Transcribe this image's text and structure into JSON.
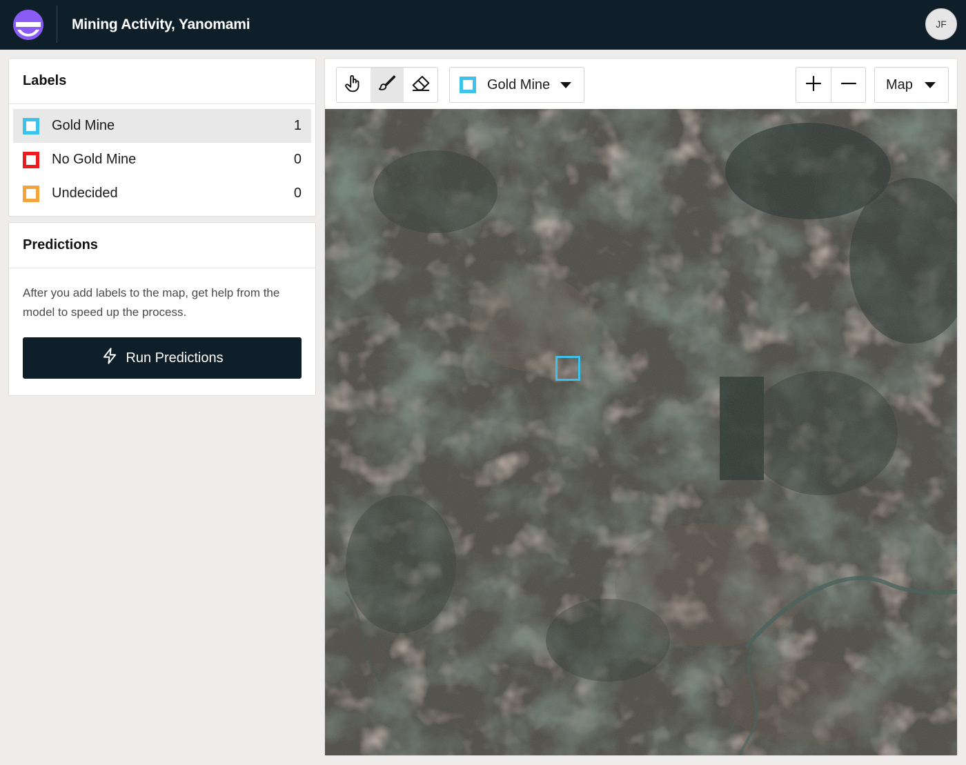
{
  "header": {
    "title": "Mining Activity, Yanomami",
    "avatar_initials": "JF",
    "logo_color": "#8a5cf6"
  },
  "labels_panel": {
    "title": "Labels",
    "items": [
      {
        "name": "Gold Mine",
        "count": "1",
        "color": "#3cc3ec",
        "selected": true
      },
      {
        "name": "No Gold Mine",
        "count": "0",
        "color": "#ee1c1c",
        "selected": false
      },
      {
        "name": "Undecided",
        "count": "0",
        "color": "#f5a33a",
        "selected": false
      }
    ]
  },
  "predictions_panel": {
    "title": "Predictions",
    "description": "After you add labels to the map, get help from the model to speed up the process.",
    "run_button_label": "Run Predictions",
    "run_button_icon": "lightning-icon"
  },
  "toolbar": {
    "tools": [
      {
        "icon": "hand-pointer-icon",
        "active": false
      },
      {
        "icon": "brush-icon",
        "active": true
      },
      {
        "icon": "eraser-icon",
        "active": false
      }
    ],
    "active_class": {
      "label": "Gold Mine",
      "color": "#3cc3ec"
    },
    "zoom_in_icon": "plus-icon",
    "zoom_out_icon": "minus-icon",
    "basemap_label": "Map"
  },
  "map": {
    "imagery": "satellite",
    "labels": [
      {
        "class": "Gold Mine",
        "color": "#3cc3ec"
      }
    ]
  }
}
